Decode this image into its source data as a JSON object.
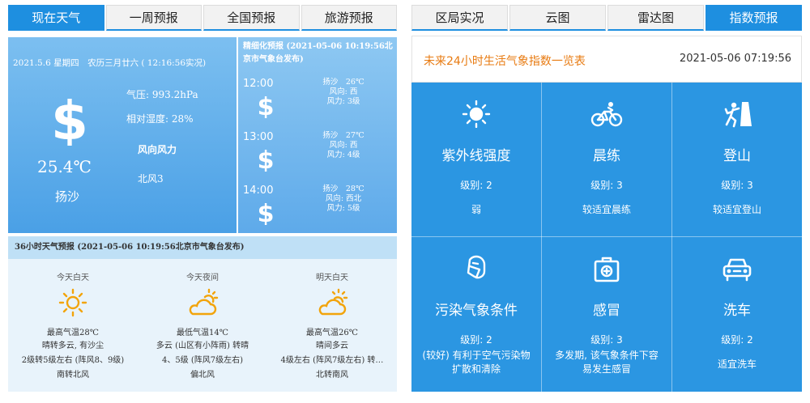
{
  "left_tabs": [
    "现在天气",
    "一周预报",
    "全国预报",
    "旅游预报"
  ],
  "right_tabs": [
    "区局实况",
    "云图",
    "雷达图",
    "指数预报"
  ],
  "current": {
    "date": "2021.5.6 星期四　农历三月廿六 ( 12:16:56实况)",
    "temperature": "25.4℃",
    "weather": "扬沙",
    "pressure": "气压: 993.2hPa",
    "humidity": "相对湿度: 28%",
    "wind_title": "风向风力",
    "wind": "北风3"
  },
  "fine_forecast": {
    "header": "精细化预报 (2021-05-06 10:19:56北京市气象台发布)",
    "rows": [
      {
        "time": "12:00",
        "weather": "扬沙　26℃",
        "wind_dir": "风向: 西",
        "wind_force": "风力: 3级"
      },
      {
        "time": "13:00",
        "weather": "扬沙　27℃",
        "wind_dir": "风向: 西",
        "wind_force": "风力: 4级"
      },
      {
        "time": "14:00",
        "weather": "扬沙　28℃",
        "wind_dir": "风向: 西北",
        "wind_force": "风力: 5级"
      }
    ]
  },
  "forecast36": {
    "header": "36小时天气预报 (2021-05-06 10:19:56北京市气象台发布)",
    "columns": [
      {
        "title": "今天白天",
        "icon": "sun-icon",
        "temp": "最高气温28℃",
        "desc": "晴转多云, 有沙尘",
        "wind": "2级转5级左右 (阵风8、9级)",
        "wind_dir": "南转北风"
      },
      {
        "title": "今天夜间",
        "icon": "cloud-moon-icon",
        "temp": "最低气温14℃",
        "desc": "多云 (山区有小阵雨) 转晴",
        "wind": "4、5级 (阵风7级左右)",
        "wind_dir": "偏北风"
      },
      {
        "title": "明天白天",
        "icon": "partly-cloudy-icon",
        "temp": "最高气温26℃",
        "desc": "晴间多云",
        "wind": "4级左右 (阵风7级左右) 转…",
        "wind_dir": "北转南风"
      }
    ]
  },
  "index": {
    "title": "未来24小时生活气象指数一览表",
    "time": "2021-05-06 07:19:56",
    "items": [
      {
        "name": "紫外线强度",
        "level": "级别: 2",
        "desc": "弱",
        "icon": "uv-sun-icon"
      },
      {
        "name": "晨练",
        "level": "级别: 3",
        "desc": "较适宜晨练",
        "icon": "cycling-icon"
      },
      {
        "name": "登山",
        "level": "级别: 3",
        "desc": "较适宜登山",
        "icon": "climbing-icon"
      },
      {
        "name": "污染气象条件",
        "level": "级别: 2",
        "desc": "(较好) 有利于空气污染物扩散和清除",
        "icon": "mask-icon"
      },
      {
        "name": "感冒",
        "level": "级别: 3",
        "desc": "多发期, 该气象条件下容易发生感冒",
        "icon": "medkit-icon"
      },
      {
        "name": "洗车",
        "level": "级别: 2",
        "desc": "适宜洗车",
        "icon": "car-icon"
      }
    ]
  },
  "colors": {
    "accent": "#1e8fe0",
    "grid_bg": "#2b96e2",
    "title_orange": "#e87b12"
  }
}
